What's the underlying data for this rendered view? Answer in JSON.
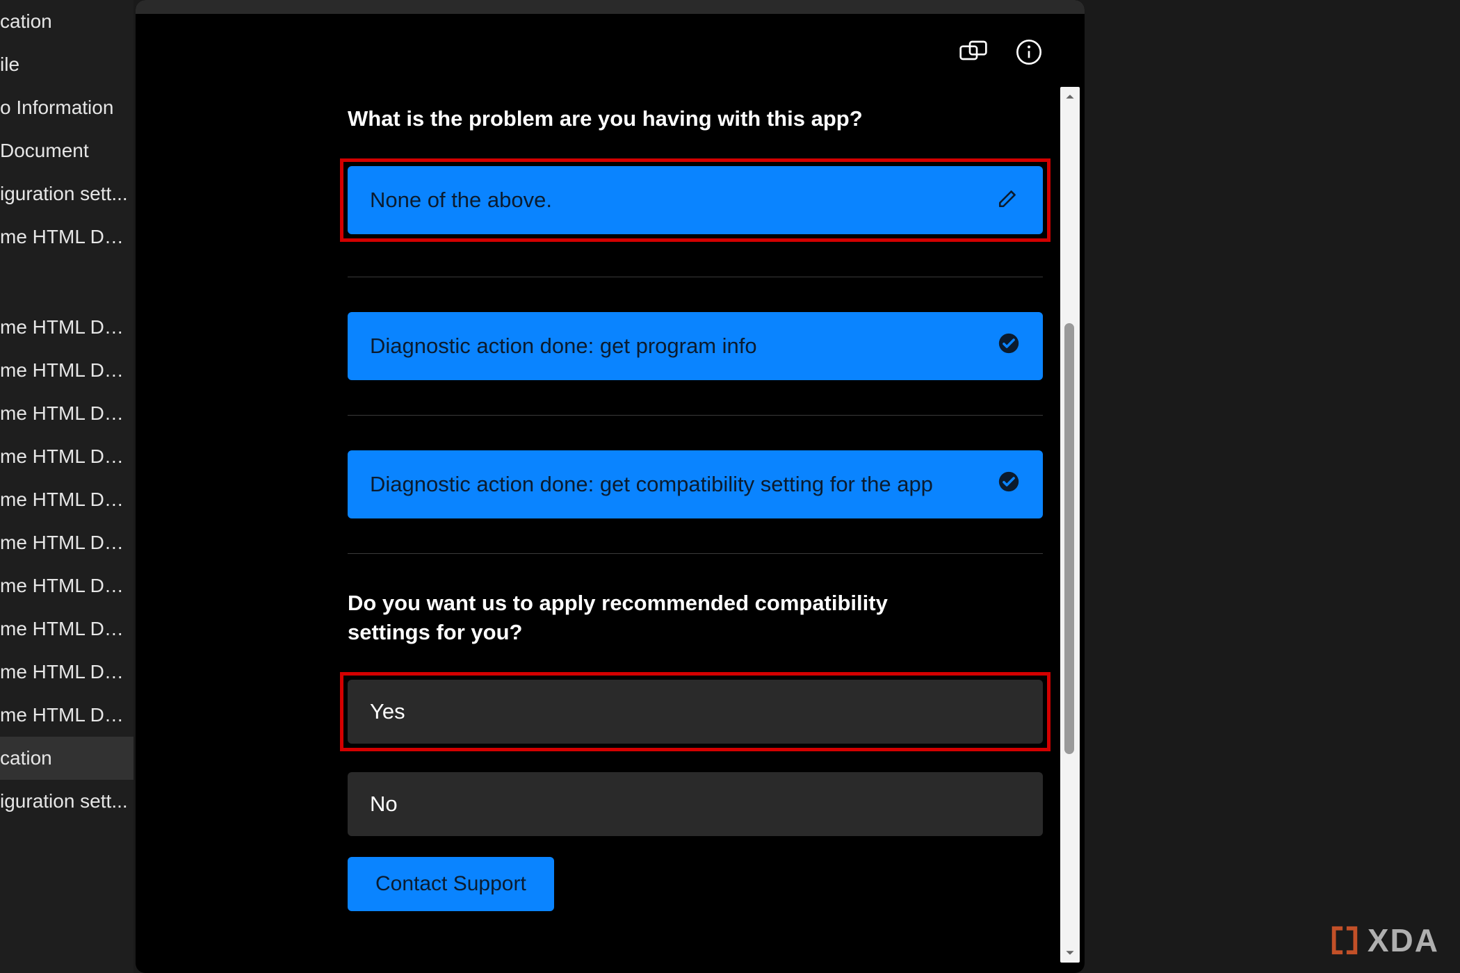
{
  "sidebar": {
    "items": [
      "cation",
      "ile",
      "o Information",
      "Document",
      "iguration sett...",
      "me HTML Do...",
      "me HTML Do...",
      "me HTML Do...",
      "me HTML Do...",
      "me HTML Do...",
      "me HTML Do...",
      "me HTML Do...",
      "me HTML Do...",
      "me HTML Do...",
      "me HTML Do...",
      "me HTML Do...",
      "cation",
      "iguration sett..."
    ],
    "selected_index": 16
  },
  "dialog": {
    "q1": "What is the problem are you having with this app?",
    "answer1": "None of the above.",
    "diag1": "Diagnostic action done: get program info",
    "diag2": "Diagnostic action done: get compatibility setting for the app",
    "q2": "Do you want us to apply recommended compatibility settings for you?",
    "yes": "Yes",
    "no": "No",
    "contact": "Contact Support"
  },
  "accent": "#0a84ff",
  "highlight": "#d30000",
  "watermark": "XDA"
}
